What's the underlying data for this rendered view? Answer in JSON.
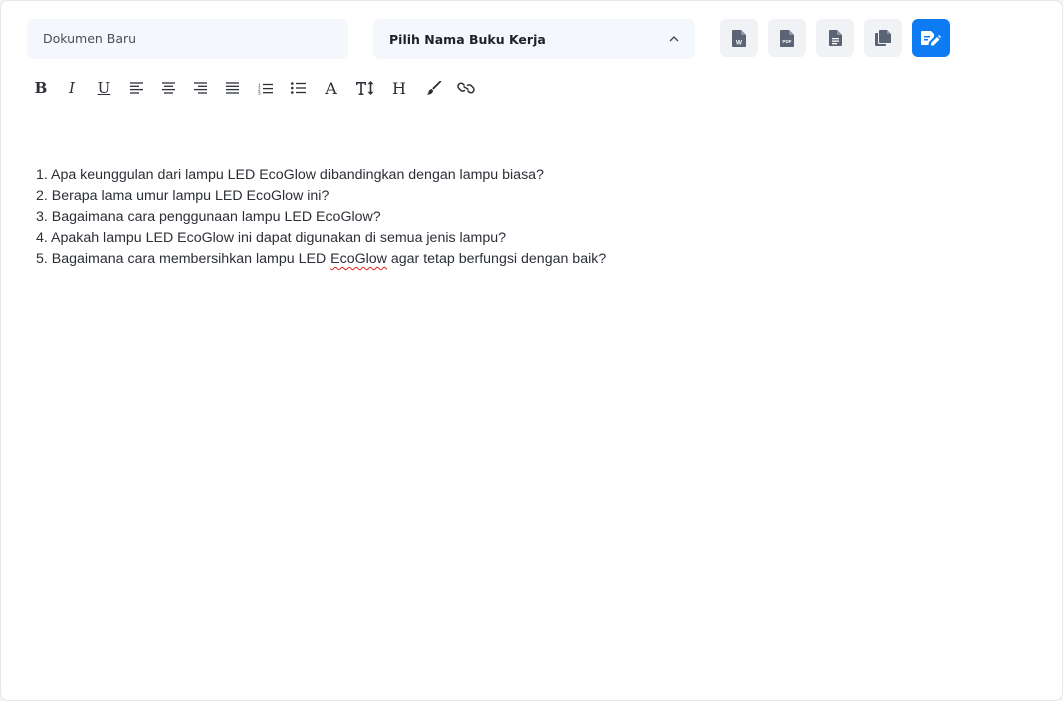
{
  "document": {
    "name_placeholder": "Dokumen Baru"
  },
  "workbook_select": {
    "label": "Pilih Nama Buku Kerja"
  },
  "export_actions": [
    {
      "name": "export-word-button",
      "icon": "word-file-icon"
    },
    {
      "name": "export-pdf-button",
      "icon": "pdf-file-icon"
    },
    {
      "name": "export-text-button",
      "icon": "text-file-icon"
    },
    {
      "name": "copy-button",
      "icon": "copy-icon"
    },
    {
      "name": "save-edit-button",
      "icon": "file-edit-icon",
      "accent": "#0d7cf2"
    }
  ],
  "toolbar": {
    "bold": "B",
    "italic": "I",
    "underline": "U",
    "font_color": "A",
    "heading": "H",
    "icons": [
      "align-left-icon",
      "align-center-icon",
      "align-right-icon",
      "align-justify-icon",
      "ordered-list-icon",
      "bullet-list-icon",
      "text-size-icon",
      "brush-icon",
      "link-icon"
    ]
  },
  "editor": {
    "lines": [
      "1. Apa keunggulan dari lampu LED EcoGlow dibandingkan dengan lampu biasa?",
      "2. Berapa lama umur lampu LED EcoGlow ini?",
      "3. Bagaimana cara penggunaan lampu LED EcoGlow?",
      "4. Apakah lampu LED EcoGlow ini dapat digunakan di semua jenis lampu?"
    ],
    "line5": {
      "before": "5. Bagaimana cara membersihkan lampu LED ",
      "misspelled": "EcoGlow",
      "after": " agar tetap berfungsi dengan baik?"
    }
  },
  "colors": {
    "accent": "#0d7cf2",
    "input_bg": "#f4f7fb",
    "spellcheck": "#e02020"
  }
}
